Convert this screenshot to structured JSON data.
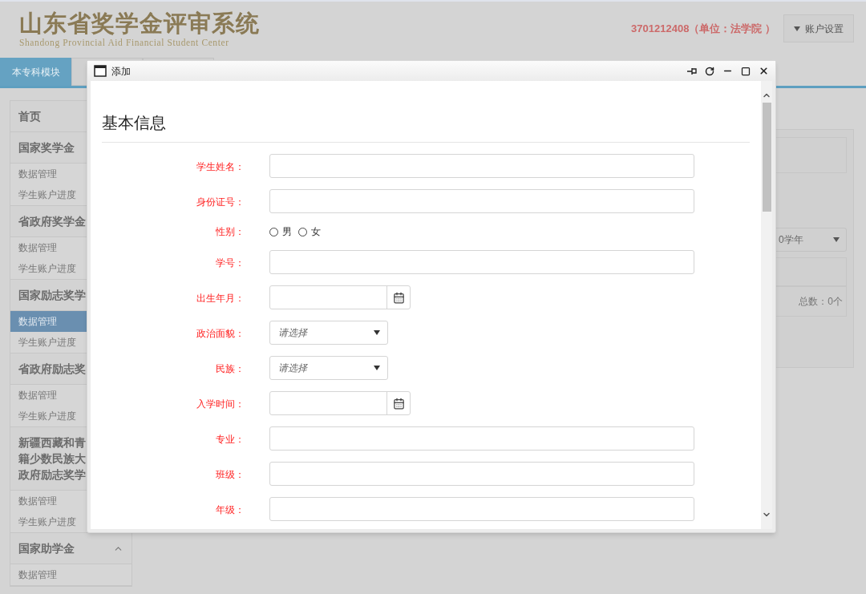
{
  "header": {
    "logo_title": "山东省奖学金评审系统",
    "logo_subtitle": "Shandong Provincial Aid Financial Student Center",
    "user_info": "3701212408（单位：法学院 ）",
    "account_button": "账户设置"
  },
  "tabs": [
    {
      "label": "本专科模块",
      "selected": true
    },
    {
      "selected": false
    },
    {
      "selected": false
    }
  ],
  "sidebar": {
    "sections": [
      {
        "title_lines": [
          "首页"
        ]
      },
      {
        "title_lines": [
          "国家奖学金"
        ],
        "children": [
          {
            "label": "数据管理",
            "selected": false
          },
          {
            "label": "学生账户进度",
            "selected": false
          }
        ]
      },
      {
        "title_lines": [
          "省政府奖学金"
        ],
        "children": [
          {
            "label": "数据管理",
            "selected": false
          },
          {
            "label": "学生账户进度",
            "selected": false
          }
        ]
      },
      {
        "title_lines": [
          "国家励志奖学"
        ],
        "children": [
          {
            "label": "数据管理",
            "selected": true
          },
          {
            "label": "学生账户进度",
            "selected": false
          }
        ]
      },
      {
        "title_lines": [
          "省政府励志奖"
        ],
        "children": [
          {
            "label": "数据管理",
            "selected": false
          },
          {
            "label": "学生账户进度",
            "selected": false
          }
        ]
      },
      {
        "title_lines": [
          "新疆西藏和青",
          "籍少数民族大",
          "政府励志奖学"
        ],
        "children": [
          {
            "label": "数据管理",
            "selected": false
          },
          {
            "label": "学生账户进度",
            "selected": false
          }
        ]
      },
      {
        "title_lines": [
          "国家助学金"
        ],
        "expanded": true,
        "children": [
          {
            "label": "数据管理",
            "selected": false
          }
        ]
      }
    ]
  },
  "content": {
    "year_select": "0学年",
    "total": "总数：0个"
  },
  "dialog": {
    "title": "添加",
    "section_title": "基本信息",
    "fields": [
      {
        "kind": "text",
        "label": "学生姓名："
      },
      {
        "kind": "text",
        "label": "身份证号："
      },
      {
        "kind": "radio",
        "label": "性别：",
        "options": [
          {
            "label": "男",
            "selected": false
          },
          {
            "label": "女",
            "selected": false
          }
        ]
      },
      {
        "kind": "text",
        "label": "学号："
      },
      {
        "kind": "date",
        "label": "出生年月："
      },
      {
        "kind": "select",
        "label": "政治面貌：",
        "placeholder": "请选择"
      },
      {
        "kind": "select",
        "label": "民族：",
        "placeholder": "请选择"
      },
      {
        "kind": "date",
        "label": "入学时间："
      },
      {
        "kind": "text",
        "label": "专业："
      },
      {
        "kind": "text",
        "label": "班级："
      },
      {
        "kind": "text",
        "label": "年级："
      }
    ]
  }
}
